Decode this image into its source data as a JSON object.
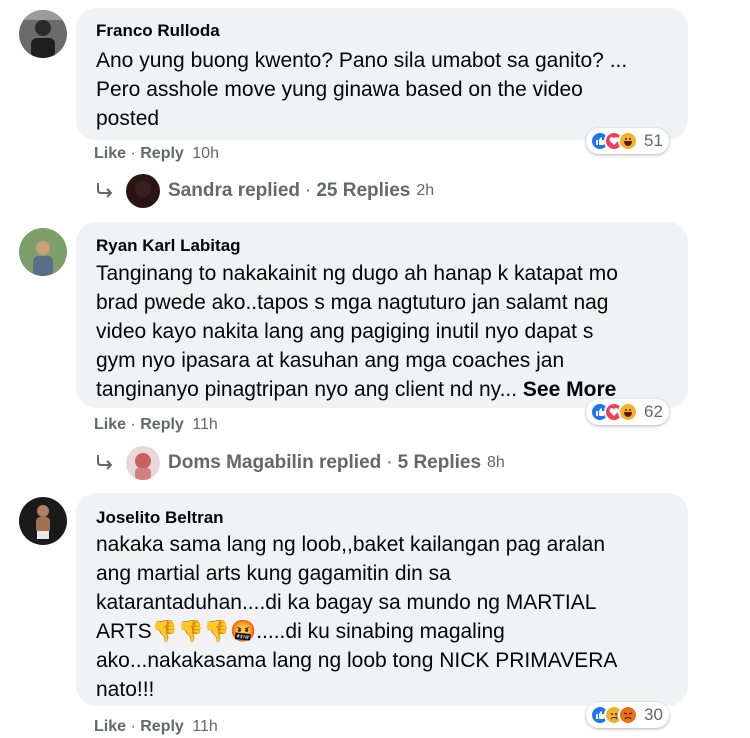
{
  "comments": [
    {
      "author": "Franco Rulloda",
      "text": "Ano yung buong kwento? Pano sila umabot sa ganito? ...\nPero asshole move yung ginawa based on the video\nposted",
      "like": "Like",
      "reply": "Reply",
      "time": "10h",
      "reactions": [
        "like-icon",
        "love-icon",
        "haha-icon"
      ],
      "reaction_count": "51",
      "replies": {
        "name": "Sandra replied",
        "count": "25 Replies",
        "time": "2h"
      }
    },
    {
      "author": "Ryan Karl Labitag",
      "text": "Tanginang to nakakainit ng dugo ah hanap k katapat mo\nbrad pwede ako..tapos s mga nagtuturo jan salamt nag\nvideo kayo nakita lang ang pagiging inutil nyo dapat s\ngym nyo ipasara at kasuhan ang mga coaches jan\ntanginanyo pinagtripan nyo ang client nd ny...",
      "see_more": "See More",
      "like": "Like",
      "reply": "Reply",
      "time": "11h",
      "reactions": [
        "like-icon",
        "love-icon",
        "haha-icon"
      ],
      "reaction_count": "62",
      "replies": {
        "name": "Doms Magabilin replied",
        "count": "5 Replies",
        "time": "8h"
      }
    },
    {
      "author": "Joselito Beltran",
      "text": "nakaka sama lang ng loob,,baket kailangan pag aralan\nang martial arts kung gagamitin din sa\nkatarantaduhan....di ka bagay sa mundo ng MARTIAL\nARTS👎👎👎🤬.....di ku sinabing magaling\nako...nakakasama lang ng loob tong NICK PRIMAVERA\nnato!!!",
      "like": "Like",
      "reply": "Reply",
      "time": "11h",
      "reactions": [
        "like-icon",
        "sad-icon",
        "angry-icon"
      ],
      "reaction_count": "30"
    }
  ],
  "separator": "·",
  "colors": {
    "like": "#1877f2",
    "love": "#f33e58",
    "haha": "#f7b125",
    "angry": "#e9710f",
    "bubble": "#f0f2f5",
    "meta": "#65676b"
  }
}
